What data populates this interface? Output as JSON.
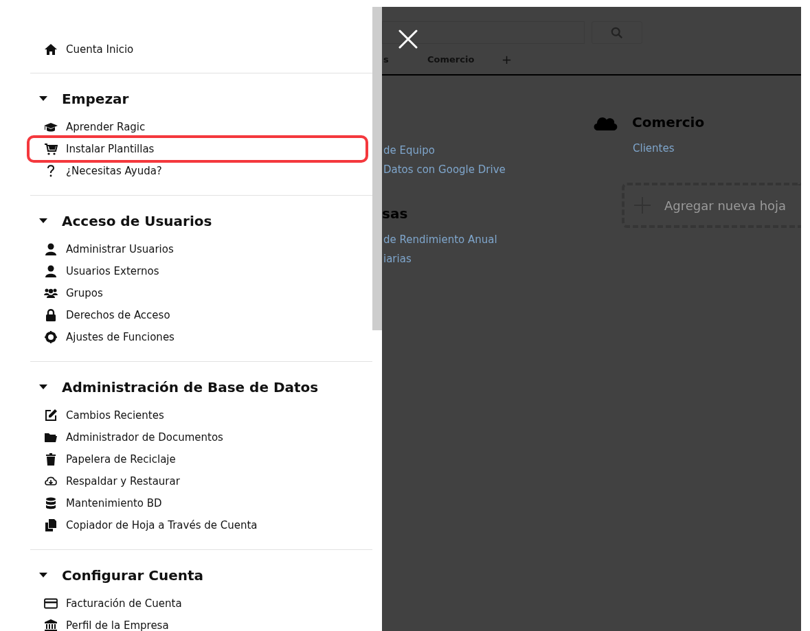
{
  "sidebar": {
    "home": {
      "label": "Cuenta Inicio"
    },
    "sections": [
      {
        "title": "Empezar",
        "expanded": true,
        "items": [
          {
            "label": "Aprender Ragic",
            "highlighted": false
          },
          {
            "label": "Instalar Plantillas",
            "highlighted": true
          },
          {
            "label": "¿Necesitas Ayuda?",
            "highlighted": false
          }
        ]
      },
      {
        "title": "Acceso de Usuarios",
        "expanded": true,
        "items": [
          {
            "label": "Administrar Usuarios",
            "highlighted": false
          },
          {
            "label": "Usuarios Externos",
            "highlighted": false
          },
          {
            "label": "Grupos",
            "highlighted": false
          },
          {
            "label": "Derechos de Acceso",
            "highlighted": false
          },
          {
            "label": "Ajustes de Funciones",
            "highlighted": false
          }
        ]
      },
      {
        "title": "Administración de Base de Datos",
        "expanded": true,
        "items": [
          {
            "label": "Cambios Recientes",
            "highlighted": false
          },
          {
            "label": "Administrador de Documentos",
            "highlighted": false
          },
          {
            "label": "Papelera de Reciclaje",
            "highlighted": false
          },
          {
            "label": "Respaldar y Restaurar",
            "highlighted": false
          },
          {
            "label": "Mantenimiento BD",
            "highlighted": false
          },
          {
            "label": "Copiador de Hoja a Través de Cuenta",
            "highlighted": false
          }
        ]
      },
      {
        "title": "Configurar Cuenta",
        "expanded": true,
        "items": [
          {
            "label": "Facturación de Cuenta",
            "highlighted": false
          },
          {
            "label": "Perfil de la Empresa",
            "highlighted": false
          }
        ]
      }
    ]
  },
  "background": {
    "tabs": [
      {
        "label": "s"
      },
      {
        "label": "Comercio"
      },
      {
        "label": "+"
      }
    ],
    "left_column": {
      "links_top": [
        "de Equipo",
        "Datos con Google Drive"
      ],
      "heading": "sas",
      "links_bottom": [
        "de Rendimiento Anual",
        "iarias"
      ]
    },
    "right_column": {
      "heading": "Comercio",
      "links": [
        "Clientes"
      ],
      "add_sheet": "Agregar nueva hoja"
    }
  }
}
